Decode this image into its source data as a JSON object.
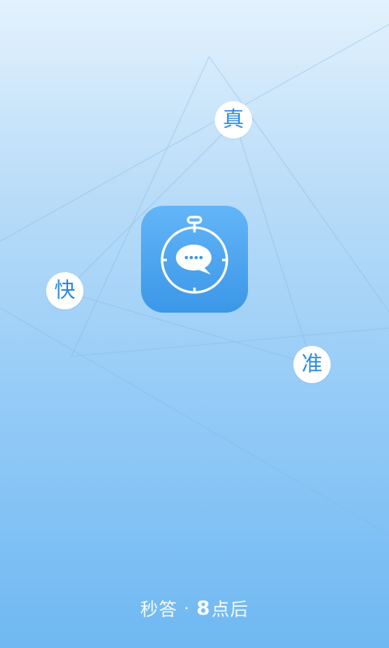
{
  "splash": {
    "bubble_top": "真",
    "bubble_left": "快",
    "bubble_right": "准"
  },
  "footer": {
    "app_name": "秒答",
    "separator": "·",
    "partner_number": "8",
    "partner_text": "点后"
  },
  "colors": {
    "background_top": "#e3f2fd",
    "background_bottom": "#6fb8f2",
    "icon": "#3b97e8",
    "bubble_text": "#2b8be0"
  },
  "icons": {
    "app_icon": "stopwatch-chat-icon"
  }
}
